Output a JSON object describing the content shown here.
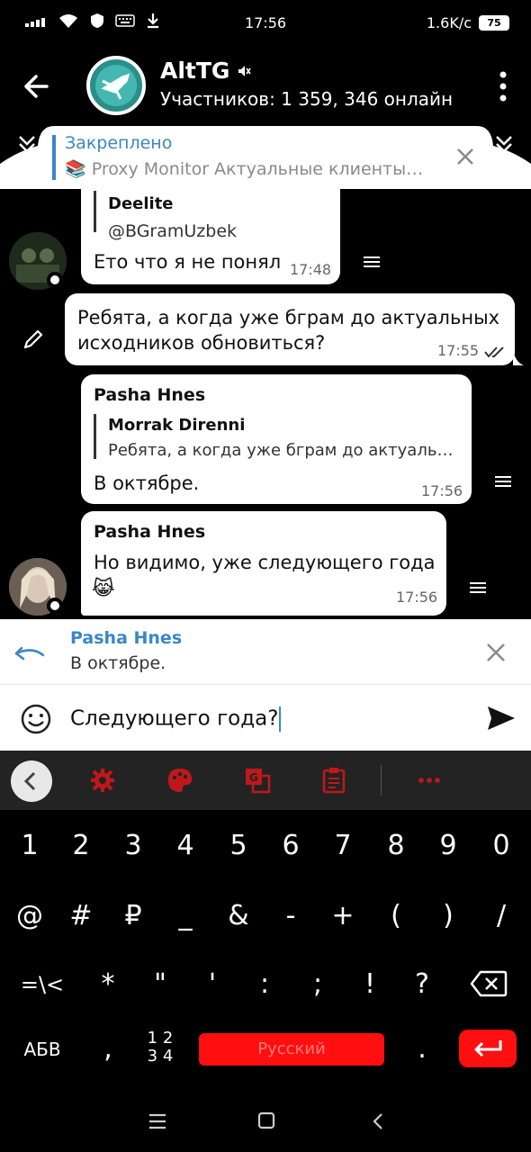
{
  "status_bar": {
    "time": "17:56",
    "signal": "....",
    "speed": "1.6K/c",
    "battery": "75"
  },
  "header": {
    "title": "AltTG",
    "subtitle": "Участников: 1 359, 346 онлайн"
  },
  "pinned": {
    "label": "Закреплено",
    "text": "📚 Proxy Monitor  Актуальные клиенты…"
  },
  "messages": [
    {
      "quote_name": "Deelite",
      "quote_text": "@BGramUzbek",
      "text": "Ето что я не понял",
      "time": "17:48"
    },
    {
      "text_line1": "Ребята, а когда уже бграм до актуальных",
      "text_line2": "исходников обновиться?",
      "time": "17:55"
    },
    {
      "sender": "Pasha Hnes",
      "quote_name": "Morrak Direnni",
      "quote_text": "Ребята, а когда уже бграм до актуаль…",
      "text": "В октябре.",
      "time": "17:56"
    },
    {
      "sender": "Pasha Hnes",
      "text": "Но видимо, уже следующего года",
      "emoji": "😹",
      "time": "17:56"
    }
  ],
  "reply": {
    "name": "Pasha Hnes",
    "text": "В октябре."
  },
  "input": {
    "value": "Следующего года?"
  },
  "keyboard": {
    "row1": [
      "1",
      "2",
      "3",
      "4",
      "5",
      "6",
      "7",
      "8",
      "9",
      "0"
    ],
    "row2": [
      "@",
      "#",
      "₽",
      "_",
      "&",
      "-",
      "+",
      "(",
      ")",
      "/"
    ],
    "row3": [
      "=\\<",
      "*",
      "\"",
      "'",
      ":",
      ";",
      "!",
      "?"
    ],
    "abc_label": "АБВ",
    "comma": ",",
    "numpad_top": "1 2",
    "numpad_bottom": "3 4",
    "space_label": "Русский",
    "period": "."
  },
  "colors": {
    "accent": "#3a87c6",
    "keyboard_red": "#ff0f0f",
    "tool_red": "#c0181a"
  }
}
